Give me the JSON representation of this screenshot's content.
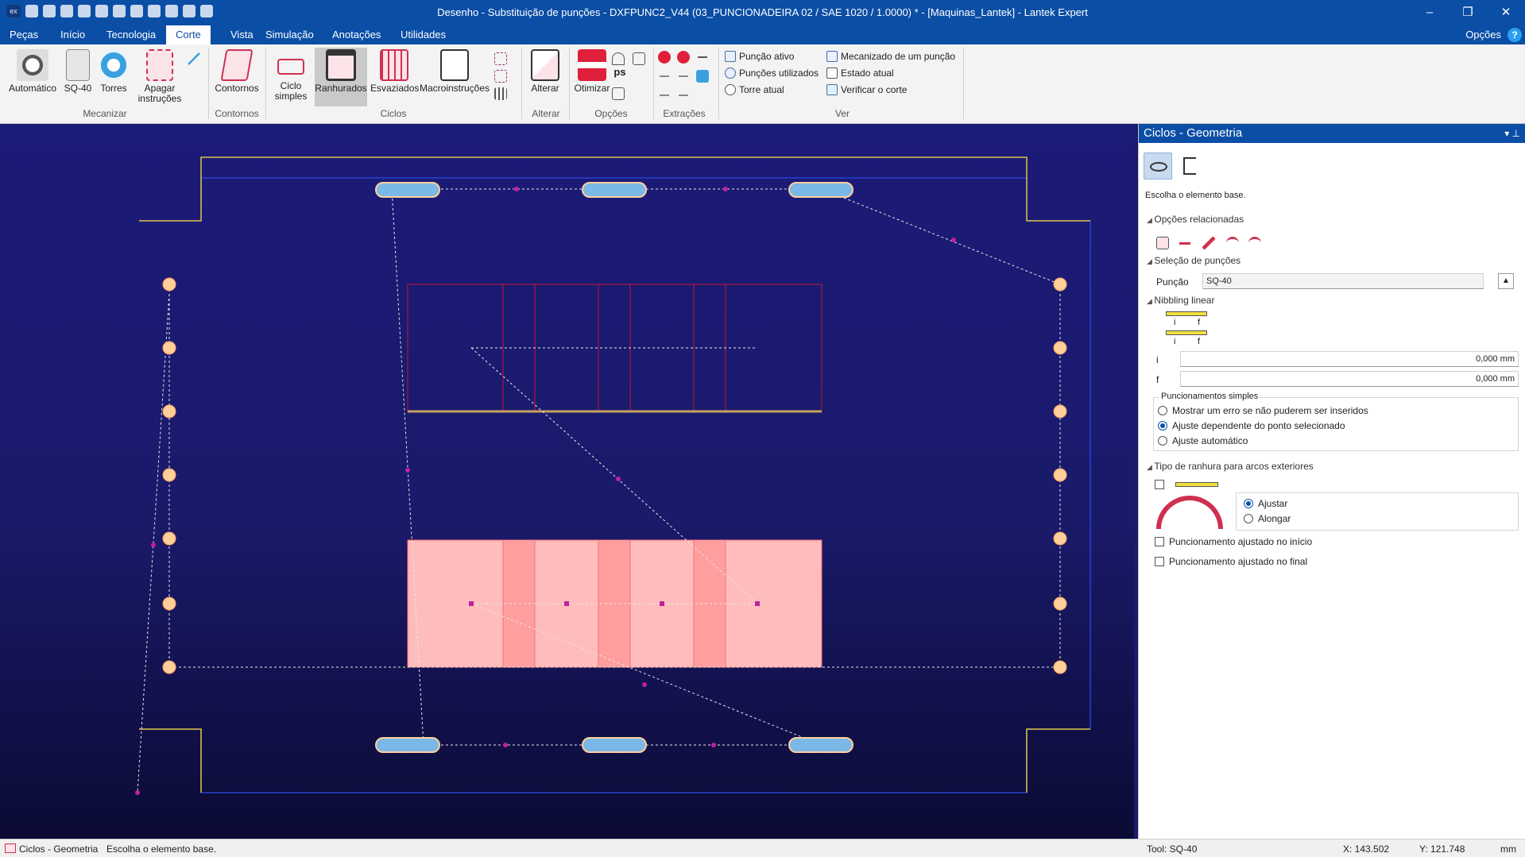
{
  "titlebar": {
    "title": "Desenho - Substituição de punções - DXFPUNC2_V44  (03_PUNCIONADEIRA 02 / SAE 1020 / 1.0000) * - [Maquinas_Lantek] - Lantek Expert",
    "logo": "ex",
    "minimize": "–",
    "restore": "❐",
    "close": "✕"
  },
  "menu": {
    "tabs": [
      "Peças",
      "Início",
      "Tecnologia",
      "Corte",
      "Vista",
      "Simulação",
      "Anotações",
      "Utilidades"
    ],
    "active": "Corte",
    "options": "Opções",
    "help": "?"
  },
  "ribbon": {
    "buttons": {
      "automatico": "Automático",
      "sq40": "SQ-40",
      "torres": "Torres",
      "apagar": "Apagar",
      "apagar2": "instruções",
      "contornos": "Contornos",
      "ciclo": "Ciclo",
      "ciclo2": "simples",
      "ranhurados": "Ranhurados",
      "esvaziados": "Esvaziados",
      "macro": "Macroinstruções",
      "alterar": "Alterar",
      "otimizar": "Otimizar",
      "ps": "ps"
    },
    "groups": {
      "mecanizar": "Mecanizar",
      "contornos": "Contornos",
      "ciclos": "Ciclos",
      "alterar": "Alterar",
      "opcoes": "Opções",
      "extracoes": "Extrações",
      "ver": "Ver"
    },
    "ver": {
      "puncao_ativo": "Punção ativo",
      "puncoes_utilizados": "Punções utilizados",
      "torre_atual": "Torre atual",
      "mecanizado": "Mecanizado de um punção",
      "estado_atual": "Estado atual",
      "verificar": "Verificar o corte"
    }
  },
  "panel": {
    "title": "Ciclos - Geometria",
    "prompt": "Escolha o elemento base.",
    "sec_opcoes": "Opções relacionadas",
    "sec_selecao": "Seleção de punções",
    "puncao_label": "Punção",
    "puncao_value": "SQ-40",
    "sec_nibbling": "Nibbling linear",
    "i_label": "i",
    "f_label": "f",
    "i_value": "0,000 mm",
    "f_value": "0,000 mm",
    "diag_i": "i",
    "diag_f": "f",
    "simple_title": "Puncionamentos simples",
    "simple_opts": [
      "Mostrar um erro se não puderem ser inseridos",
      "Ajuste dependente do ponto selecionado",
      "Ajuste automático"
    ],
    "simple_selected": 1,
    "sec_ranhura": "Tipo de ranhura para arcos exteriores",
    "arc_opts": [
      "Ajustar",
      "Alongar"
    ],
    "arc_selected": 0,
    "chk_inicio": "Puncionamento ajustado no início",
    "chk_final": "Puncionamento ajustado no final"
  },
  "status": {
    "left": "Ciclos - Geometria",
    "prompt": "Escolha o elemento base.",
    "tool": "Tool: SQ-40",
    "x": "X: 143.502",
    "y": "Y: 121.748",
    "unit": "mm"
  },
  "colors": {
    "accent": "#0b4ea6",
    "canvas": "#1a1a6e",
    "part_outline": "#e0c040",
    "slot_fill": "#ffbcbc",
    "slot_dark": "#ff9e9e",
    "punch": "#ffcf9a"
  }
}
